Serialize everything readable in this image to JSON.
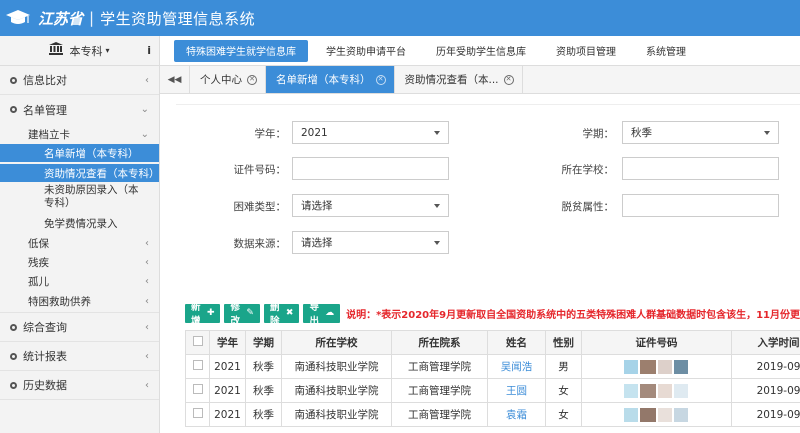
{
  "header": {
    "brand": "江苏省",
    "title": "学生资助管理信息系统",
    "colors": {
      "primary": "#3c8dd8",
      "green": "#1aa58a",
      "red": "#e5262b"
    }
  },
  "sidebar": {
    "level_select": "本专科",
    "menu": {
      "m1": "信息比对",
      "m2": "名单管理",
      "m2_sub": "建档立卡",
      "leaf1": "名单新增（本专科）",
      "leaf2": "资助情况查看（本专科）",
      "leaf3": "未资助原因录入（本专科）",
      "leaf4": "免学费情况录入",
      "s2": "低保",
      "s3": "残疾",
      "s4": "孤儿",
      "s5": "特困救助供养",
      "m3": "综合查询",
      "m4": "统计报表",
      "m5": "历史数据"
    }
  },
  "topnav": {
    "n1": "特殊困难学生就学信息库",
    "n2": "学生资助申请平台",
    "n3": "历年受助学生信息库",
    "n4": "资助项目管理",
    "n5": "系统管理"
  },
  "tabs": {
    "t1": "个人中心",
    "t2": "名单新增（本专科）",
    "t3": "资助情况查看（本..."
  },
  "form": {
    "year_label": "学年：",
    "year_value": "2021",
    "term_label": "学期：",
    "term_value": "秋季",
    "id_label": "证件号码：",
    "school_label": "所在学校：",
    "hardship_label": "困难类型：",
    "hardship_value": "请选择",
    "poverty_label": "脱贫属性：",
    "source_label": "数据来源：",
    "source_value": "请选择"
  },
  "toolbar": {
    "add": "新增",
    "edit": "修改",
    "delete": "删除",
    "export": "导出",
    "note": "说明：*表示2020年9月更新取自全国资助系统中的五类特殊困难人群基础数据时包含该生，11月份更"
  },
  "table": {
    "headers": {
      "year": "学年",
      "term": "学期",
      "school": "所在学校",
      "dept": "所在院系",
      "name": "姓名",
      "gender": "性别",
      "idno": "证件号码",
      "enroll": "入学时间"
    },
    "rows": [
      {
        "year": "2021",
        "term": "秋季",
        "school": "南通科技职业学院",
        "dept": "工商管理学院",
        "name": "吴闻浩",
        "gender": "男",
        "enroll": "2019-09"
      },
      {
        "year": "2021",
        "term": "秋季",
        "school": "南通科技职业学院",
        "dept": "工商管理学院",
        "name": "王圆",
        "gender": "女",
        "enroll": "2019-09"
      },
      {
        "year": "2021",
        "term": "秋季",
        "school": "南通科技职业学院",
        "dept": "工商管理学院",
        "name": "袁霜",
        "gender": "女",
        "enroll": "2019-09"
      }
    ]
  }
}
